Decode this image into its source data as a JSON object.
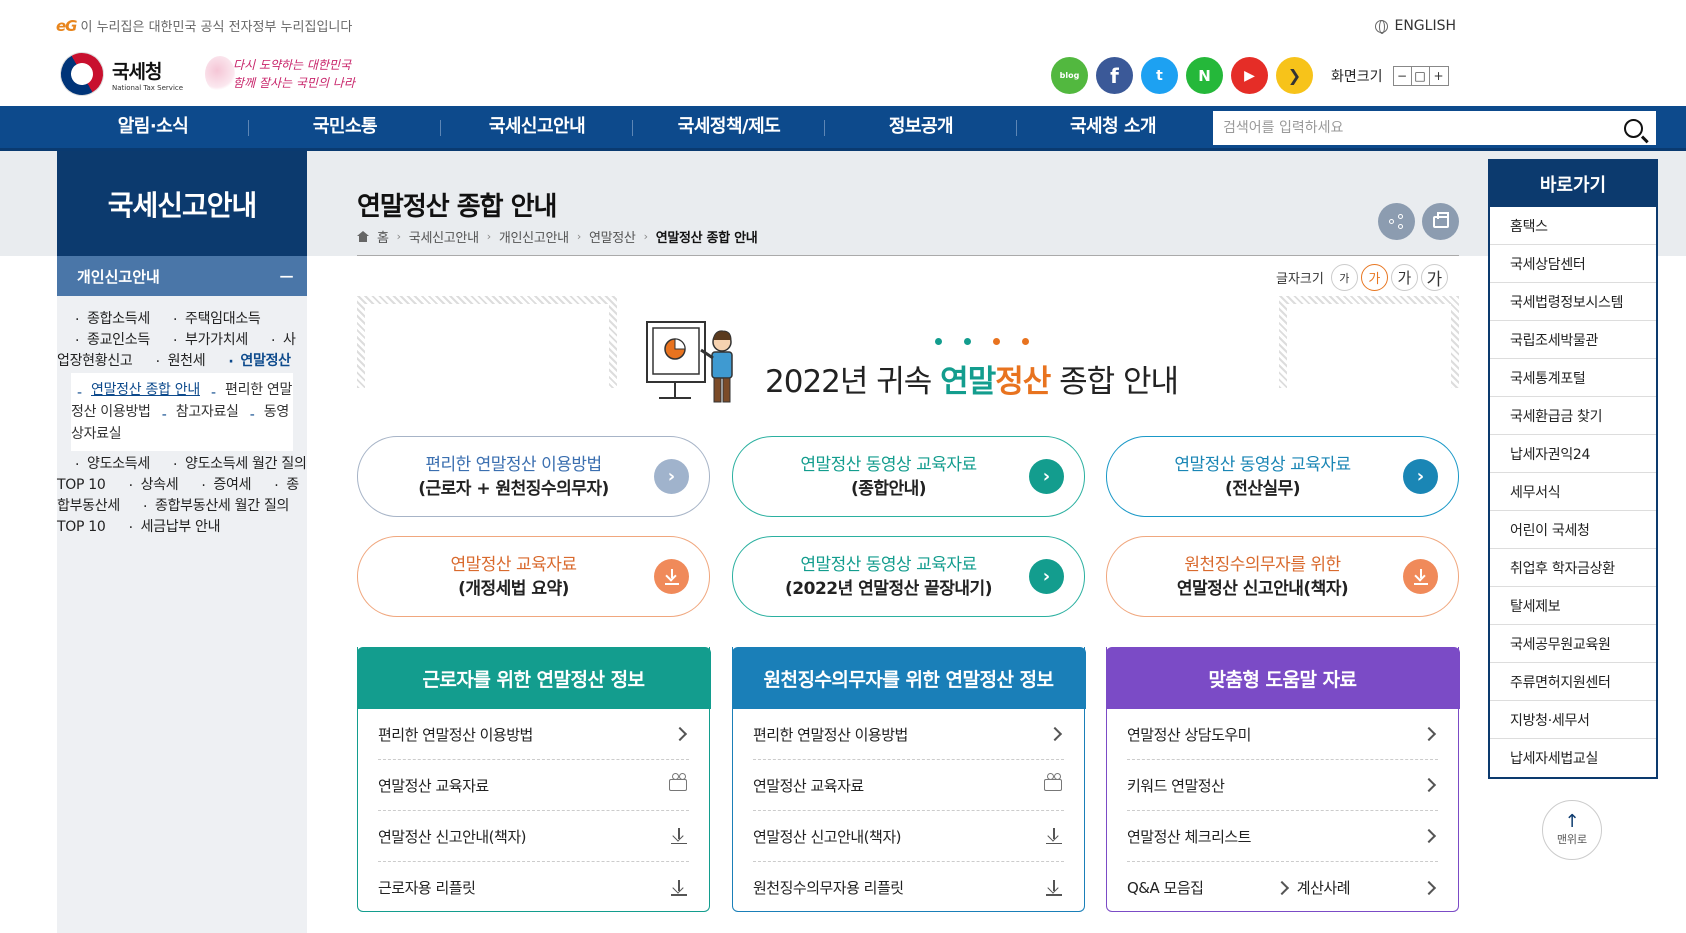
{
  "gov_banner": {
    "mark": "eG",
    "text": "이 누리집은 대한민국 공식 전자정부 누리집입니다"
  },
  "english_link": "ENGLISH",
  "logo": {
    "name_kr": "국세청",
    "name_en": "National Tax Service",
    "slogan_line1": "다시 도약하는 대한민국",
    "slogan_line2": "함께 잘사는 국민의 나라"
  },
  "social": [
    {
      "icon": "blog-icon",
      "label": "blog"
    },
    {
      "icon": "facebook-icon",
      "label": "f"
    },
    {
      "icon": "twitter-icon",
      "label": "t"
    },
    {
      "icon": "naver-post-icon",
      "label": "N"
    },
    {
      "icon": "youtube-icon",
      "label": "▶"
    },
    {
      "icon": "kakao-story-icon",
      "label": "❯"
    }
  ],
  "screen_size": {
    "label": "화면크기",
    "minus": "−",
    "reset": "□",
    "plus": "+"
  },
  "gnb": [
    "알림·소식",
    "국민소통",
    "국세신고안내",
    "국세정책/제도",
    "정보공개",
    "국세청 소개"
  ],
  "search": {
    "placeholder": "검색어를 입력하세요"
  },
  "lnb": {
    "title": "국세신고안내",
    "sub_title": "개인신고안내",
    "items_before": [
      "종합소득세",
      "주택임대소득",
      "종교인소득",
      "부가가치세",
      "사업장현황신고",
      "원천세",
      "연말정산"
    ],
    "sub_items": [
      "연말정산 종합 안내",
      "편리한 연말정산 이용방법",
      "참고자료실",
      "동영상자료실"
    ],
    "items_after": [
      "양도소득세",
      "양도소득세 월간 질의 TOP 10",
      "상속세",
      "증여세",
      "종합부동산세",
      "종합부동산세 월간 질의 TOP 10",
      "세금납부 안내"
    ]
  },
  "page": {
    "title": "연말정산 종합 안내",
    "breadcrumb": [
      "홈",
      "국세신고안내",
      "개인신고안내",
      "연말정산",
      "연말정산 종합 안내"
    ],
    "font_size_label": "글자크기",
    "font_sizes": [
      "가",
      "가",
      "가",
      "가"
    ]
  },
  "hero": {
    "prefix": "2022년 귀속 ",
    "hl1": "연말",
    "hl2": "정산",
    "suffix": " 종합 안내"
  },
  "pills": [
    {
      "title": "편리한 연말정산 이용방법",
      "sub": "(근로자 + 원천징수의무자)",
      "style": "blue",
      "icon": "arrow-right-icon"
    },
    {
      "title": "연말정산 동영상 교육자료",
      "sub": "(종합안내)",
      "style": "teal",
      "icon": "arrow-right-icon"
    },
    {
      "title": "연말정산 동영상 교육자료",
      "sub": "(전산실무)",
      "style": "cyan",
      "icon": "arrow-right-icon"
    },
    {
      "title": "연말정산 교육자료",
      "sub": "(개정세법 요약)",
      "style": "orange",
      "icon": "download-icon"
    },
    {
      "title": "연말정산 동영상 교육자료",
      "sub": "(2022년 연말정산 끝장내기)",
      "style": "teal",
      "icon": "arrow-right-icon"
    },
    {
      "title": "원천징수의무자를 위한",
      "sub": "연말정산 신고안내(책자)",
      "style": "orange",
      "icon": "download-icon"
    }
  ],
  "boxes": [
    {
      "title": "근로자를 위한 연말정산 정보",
      "rows": [
        {
          "label": "편리한 연말정산 이용방법",
          "icon": "chevron"
        },
        {
          "label": "연말정산 교육자료",
          "icon": "camera"
        },
        {
          "label": "연말정산 신고안내(책자)",
          "icon": "download"
        },
        {
          "label": "근로자용 리플릿",
          "icon": "download"
        }
      ]
    },
    {
      "title": "원천징수의무자를 위한 연말정산 정보",
      "rows": [
        {
          "label": "편리한 연말정산 이용방법",
          "icon": "chevron"
        },
        {
          "label": "연말정산 교육자료",
          "icon": "camera"
        },
        {
          "label": "연말정산 신고안내(책자)",
          "icon": "download"
        },
        {
          "label": "원천징수의무자용 리플릿",
          "icon": "download"
        }
      ]
    },
    {
      "title": "맞춤형 도움말 자료",
      "rows": [
        {
          "label": "연말정산 상담도우미",
          "icon": "chevron"
        },
        {
          "label": "키워드 연말정산",
          "icon": "chevron"
        },
        {
          "label": "연말정산 체크리스트",
          "icon": "chevron"
        }
      ],
      "split_row": {
        "left": "Q&A 모음집",
        "right": "계산사례"
      }
    }
  ],
  "quick": {
    "title": "바로가기",
    "items": [
      "홈택스",
      "국세상담센터",
      "국세법령정보시스템",
      "국립조세박물관",
      "국세통계포털",
      "국세환급금 찾기",
      "납세자권익24",
      "세무서식",
      "어린이 국세청",
      "취업후 학자금상환",
      "탈세제보",
      "국세공무원교육원",
      "주류면허지원센터",
      "지방청·세무서",
      "납세자세법교실"
    ]
  },
  "to_top": "맨위로",
  "colors": {
    "navy": "#0c3a6e",
    "gnb": "#0d4a8c",
    "teal": "#139d8e",
    "orange": "#e8731f",
    "purple": "#7b4bc6"
  }
}
